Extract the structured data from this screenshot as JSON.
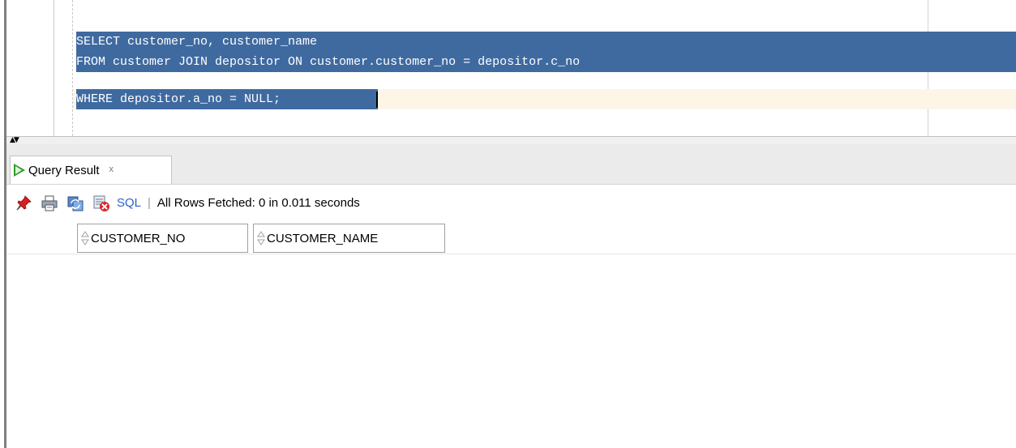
{
  "editor": {
    "lines": [
      "SELECT customer_no, customer_name",
      "FROM customer JOIN depositor ON customer.customer_no = depositor.c_no",
      "WHERE depositor.a_no = NULL;"
    ]
  },
  "splitter": {
    "arrows": "▲▼"
  },
  "results_tab": {
    "label": "Query Result",
    "close": "x"
  },
  "toolbar": {
    "icons": [
      "pin-icon",
      "print-icon",
      "refresh-icon",
      "clear-icon"
    ],
    "sql_label": "SQL",
    "separator": "|",
    "status": "All Rows Fetched: 0 in 0.011 seconds"
  },
  "grid": {
    "columns": [
      "CUSTOMER_NO",
      "CUSTOMER_NAME"
    ],
    "rows": []
  },
  "colors": {
    "selection": "#3f6aa0",
    "current_line": "#fdf6e6",
    "run_green": "#2f9c2f",
    "sql_link": "#2a62c8"
  }
}
